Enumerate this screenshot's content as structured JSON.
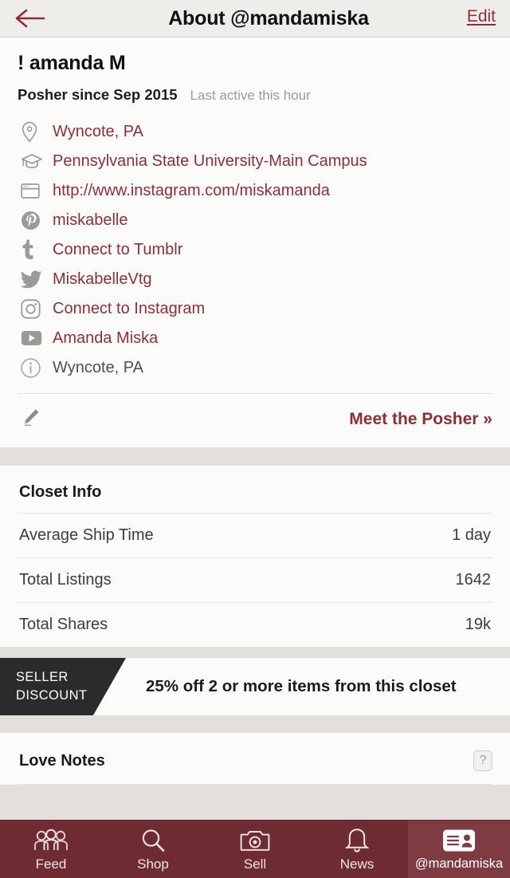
{
  "header": {
    "back_icon": "back-arrow-icon",
    "title": "About @mandamiska",
    "edit_label": "Edit"
  },
  "profile": {
    "display_name": "! amanda M",
    "posher_since": "Posher since Sep 2015",
    "last_active": "Last active this hour"
  },
  "links": [
    {
      "icon": "location-pin-icon",
      "label": "Wyncote, PA",
      "style": "link"
    },
    {
      "icon": "graduation-cap-icon",
      "label": "Pennsylvania State University-Main Campus",
      "style": "link"
    },
    {
      "icon": "browser-window-icon",
      "label": "http://www.instagram.com/miskamanda",
      "style": "link"
    },
    {
      "icon": "pinterest-icon",
      "label": "miskabelle",
      "style": "link"
    },
    {
      "icon": "tumblr-icon",
      "label": "Connect to Tumblr",
      "style": "link"
    },
    {
      "icon": "twitter-icon",
      "label": "MiskabelleVtg",
      "style": "link"
    },
    {
      "icon": "instagram-icon",
      "label": "Connect to Instagram",
      "style": "link"
    },
    {
      "icon": "youtube-icon",
      "label": "Amanda Miska",
      "style": "link"
    },
    {
      "icon": "info-circle-icon",
      "label": "Wyncote, PA",
      "style": "muted"
    }
  ],
  "meet_posher": {
    "pencil_icon": "pencil-icon",
    "label": "Meet the Posher »"
  },
  "closet_info": {
    "title": "Closet Info",
    "rows": [
      {
        "label": "Average Ship Time",
        "value": "1 day"
      },
      {
        "label": "Total Listings",
        "value": "1642"
      },
      {
        "label": "Total Shares",
        "value": "19k"
      }
    ]
  },
  "seller_discount": {
    "tag_line1": "SELLER",
    "tag_line2": "DISCOUNT",
    "text": "25% off 2 or more items from this closet"
  },
  "love_notes": {
    "title": "Love Notes",
    "help_label": "?"
  },
  "tabbar": {
    "tabs": [
      {
        "icon": "people-icon",
        "label": "Feed",
        "active": false
      },
      {
        "icon": "search-icon",
        "label": "Shop",
        "active": false
      },
      {
        "icon": "camera-icon",
        "label": "Sell",
        "active": false
      },
      {
        "icon": "bell-icon",
        "label": "News",
        "active": false
      },
      {
        "icon": "contact-card-icon",
        "label": "@mandamiska",
        "active": true
      }
    ]
  },
  "colors": {
    "brand_maroon": "#8c2f39",
    "tabbar_bg": "#6e2b32",
    "tab_active_bg": "#7e3b42",
    "page_bg": "#e3e0db",
    "card_bg": "#fbfbfa",
    "header_bg": "#eeedea",
    "discount_tag_bg": "#2b2b2b"
  }
}
